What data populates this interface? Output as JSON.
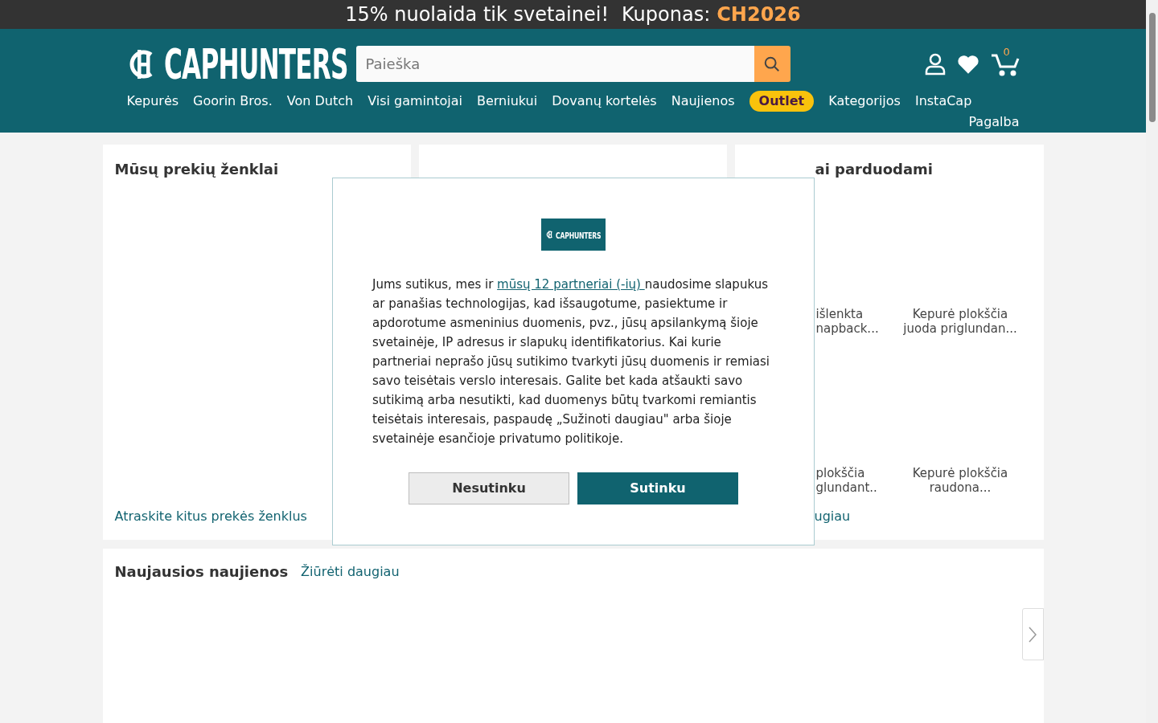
{
  "promo_bar": {
    "text": "15% nuolaida tik svetainei!",
    "coupon_label": "Kuponas:",
    "coupon_code": "CH2026"
  },
  "header": {
    "logo": "CAPHUNTERS",
    "search": {
      "placeholder": "Paieška"
    },
    "cart_count": "0",
    "nav": [
      {
        "label": "Kepurės",
        "kind": "link"
      },
      {
        "label": "Goorin Bros.",
        "kind": "link"
      },
      {
        "label": "Von Dutch",
        "kind": "link"
      },
      {
        "label": "Visi gamintojai",
        "kind": "link"
      },
      {
        "label": "Berniukui",
        "kind": "link"
      },
      {
        "label": "Dovanų kortelės",
        "kind": "link"
      },
      {
        "label": "Naujienos",
        "kind": "link"
      },
      {
        "label": "Outlet",
        "kind": "badge"
      },
      {
        "label": "Kategorijos",
        "kind": "link"
      },
      {
        "label": "InstaCap",
        "kind": "link"
      },
      {
        "label": "Pagalba",
        "kind": "link"
      }
    ]
  },
  "brands_card": {
    "title": "Mūsų prekių ženklai",
    "link": "Atraskite kitus prekės ženklus"
  },
  "bestsellers_card": {
    "title": "ai parduodami",
    "link": "ugiau",
    "products": [
      {
        "name": "išlenkta napback...",
        "cut": true
      },
      {
        "name": "Kepurė plokščia juoda priglundan...",
        "cut": false
      },
      {
        "name": "plokščia glundant..",
        "cut": true
      },
      {
        "name": "Kepurė plokščia raudona...",
        "cut": false
      }
    ]
  },
  "news_section": {
    "title": "Naujausios naujienos",
    "link": "Žiūrėti daugiau"
  },
  "consent_dialog": {
    "logo": "CAPHUNTERS",
    "text_before": "Jums sutikus, mes ir ",
    "link": "mūsų 12 partneriai (-ių) ",
    "text_after": "naudosime slapukus ar panašias technologijas, kad išsaugotume, pasiektume ir apdorotume asmeninius duomenis, pvz., jūsų apsilankymą šioje svetainėje, IP adresus ir slapukų identifikatorius. Kai kurie partneriai neprašo jūsų sutikimo tvarkyti jūsų duomenis ir remiasi savo teisėtais verslo interesais. Galite bet kada atšaukti savo sutikimą arba nesutikti, kad duomenys būtų tvarkomi remiantis teisėtais interesais, paspaudę „Sužinoti daugiau\" arba šioje svetainėje esančioje privatumo politikoje.",
    "buttons": [
      {
        "label": "Nesutinku",
        "kind": "secondary"
      },
      {
        "label": "Sutinku",
        "kind": "primary"
      }
    ]
  }
}
